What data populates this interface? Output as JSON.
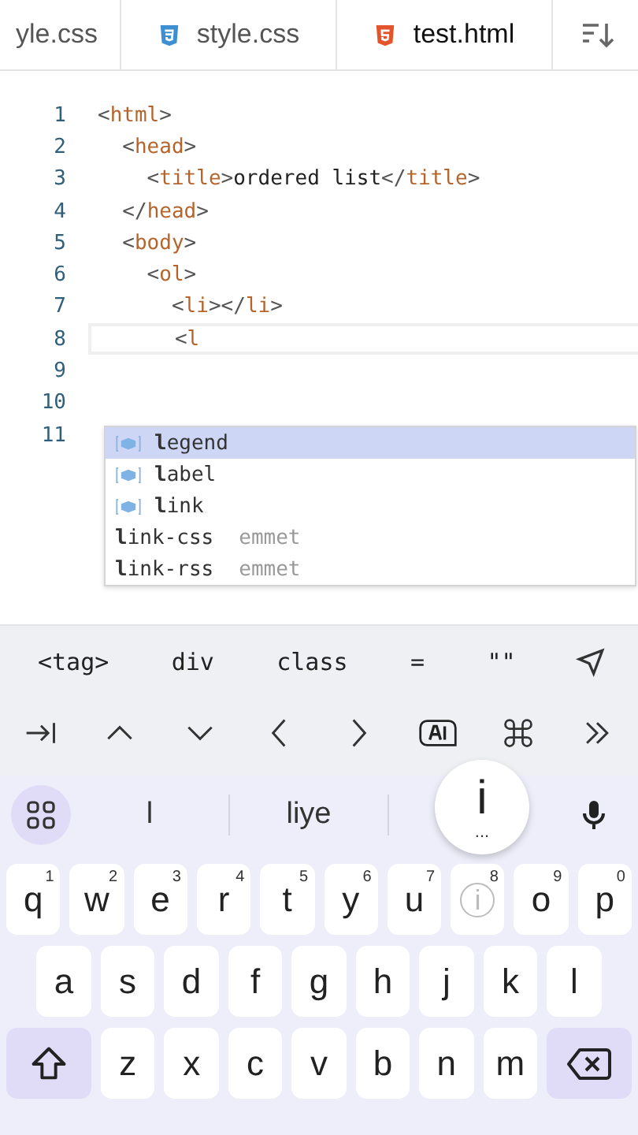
{
  "tabs": [
    {
      "label": "yle.css",
      "kind": "plain",
      "selected": false
    },
    {
      "label": "style.css",
      "kind": "css",
      "selected": false
    },
    {
      "label": "test.html",
      "kind": "html",
      "selected": true
    }
  ],
  "editor": {
    "lines": [
      {
        "number": "1",
        "current": false,
        "tokens": [
          {
            "kind": "punct",
            "text": "<"
          },
          {
            "kind": "tag",
            "text": "html"
          },
          {
            "kind": "punct",
            "text": ">"
          }
        ]
      },
      {
        "number": "2",
        "current": false,
        "tokens": [
          {
            "kind": "punct",
            "text": "  <"
          },
          {
            "kind": "tag",
            "text": "head"
          },
          {
            "kind": "punct",
            "text": ">"
          }
        ]
      },
      {
        "number": "3",
        "current": false,
        "tokens": [
          {
            "kind": "punct",
            "text": "    <"
          },
          {
            "kind": "tag",
            "text": "title"
          },
          {
            "kind": "punct",
            "text": ">"
          },
          {
            "kind": "text",
            "text": "ordered list"
          },
          {
            "kind": "punct",
            "text": "</"
          },
          {
            "kind": "tag",
            "text": "title"
          },
          {
            "kind": "punct",
            "text": ">"
          }
        ]
      },
      {
        "number": "4",
        "current": false,
        "tokens": [
          {
            "kind": "punct",
            "text": "  </"
          },
          {
            "kind": "tag",
            "text": "head"
          },
          {
            "kind": "punct",
            "text": ">"
          }
        ]
      },
      {
        "number": "5",
        "current": false,
        "tokens": [
          {
            "kind": "punct",
            "text": "  <"
          },
          {
            "kind": "tag",
            "text": "body"
          },
          {
            "kind": "punct",
            "text": ">"
          }
        ]
      },
      {
        "number": "6",
        "current": false,
        "tokens": [
          {
            "kind": "punct",
            "text": "    <"
          },
          {
            "kind": "tag",
            "text": "ol"
          },
          {
            "kind": "punct",
            "text": ">"
          }
        ]
      },
      {
        "number": "7",
        "current": false,
        "tokens": [
          {
            "kind": "punct",
            "text": "      <"
          },
          {
            "kind": "tag",
            "text": "li"
          },
          {
            "kind": "punct",
            "text": "></"
          },
          {
            "kind": "tag",
            "text": "li"
          },
          {
            "kind": "punct",
            "text": ">"
          }
        ]
      },
      {
        "number": "8",
        "current": true,
        "tokens": [
          {
            "kind": "punct",
            "text": "      <"
          },
          {
            "kind": "tag",
            "text": "l"
          }
        ]
      },
      {
        "number": "9",
        "current": false
      },
      {
        "number": "10",
        "current": false
      },
      {
        "number": "11",
        "current": false
      }
    ],
    "completions": [
      {
        "kind": "tag",
        "label": "**l**egend",
        "selected": true
      },
      {
        "kind": "tag",
        "label": "**l**abel",
        "selected": false
      },
      {
        "kind": "tag",
        "label": "**l**ink",
        "selected": false
      },
      {
        "kind": "snippet",
        "label": "**l**ink-css",
        "detail": "emmet",
        "selected": false
      },
      {
        "kind": "snippet",
        "label": "**l**ink-rss",
        "detail": "emmet",
        "selected": false
      }
    ]
  },
  "snippet_bar": [
    "<tag>",
    "div",
    "class",
    "=",
    "\"\""
  ],
  "keyboard": {
    "suggestions": [
      "l",
      "liye"
    ],
    "popup": "i",
    "popup_more": "...",
    "rows": [
      [
        {
          "label": "q",
          "hint": "1",
          "pressed": false
        },
        {
          "label": "w",
          "hint": "2",
          "pressed": false
        },
        {
          "label": "e",
          "hint": "3",
          "pressed": false
        },
        {
          "label": "r",
          "hint": "4",
          "pressed": false
        },
        {
          "label": "t",
          "hint": "5",
          "pressed": false
        },
        {
          "label": "y",
          "hint": "6",
          "pressed": false
        },
        {
          "label": "u",
          "hint": "7",
          "pressed": false
        },
        {
          "label": "i",
          "hint": "8",
          "pressed": true
        },
        {
          "label": "o",
          "hint": "9",
          "pressed": false
        },
        {
          "label": "p",
          "hint": "0",
          "pressed": false
        }
      ],
      [
        {
          "label": "a",
          "pressed": false
        },
        {
          "label": "s",
          "pressed": false
        },
        {
          "label": "d",
          "pressed": false
        },
        {
          "label": "f",
          "pressed": false
        },
        {
          "label": "g",
          "pressed": false
        },
        {
          "label": "h",
          "pressed": false
        },
        {
          "label": "j",
          "pressed": false
        },
        {
          "label": "k",
          "pressed": false
        },
        {
          "label": "l",
          "pressed": false
        }
      ],
      [
        {
          "label": "z",
          "pressed": false
        },
        {
          "label": "x",
          "pressed": false
        },
        {
          "label": "c",
          "pressed": false
        },
        {
          "label": "v",
          "pressed": false
        },
        {
          "label": "b",
          "pressed": false
        },
        {
          "label": "n",
          "pressed": false
        },
        {
          "label": "m",
          "pressed": false
        }
      ]
    ]
  }
}
